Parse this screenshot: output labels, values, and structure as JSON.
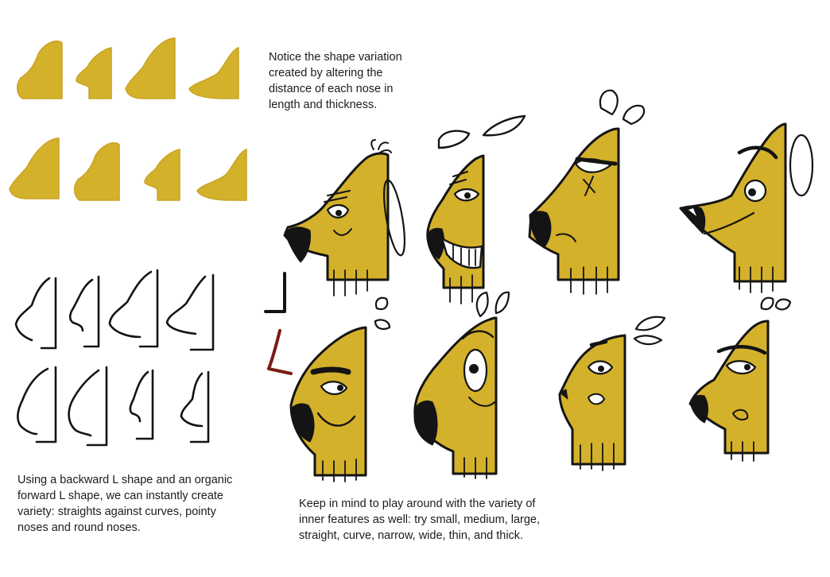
{
  "captions": {
    "top": "Notice the shape variation\ncreated by altering the\ndistance of each nose in\nlength and thickness.",
    "bottom_left": "Using a backward L shape and an organic\nforward L shape, we can instantly create\nvariety: straights against curves, pointy\nnoses and round noses.",
    "bottom_right": "Keep in mind to play around with the variety of\ninner features as well: try small, medium, large,\nstraight, curve, narrow, wide, thin, and thick."
  },
  "colors": {
    "mustard": "#D4B12A",
    "mustard_dark": "#C9A323",
    "ink": "#141414",
    "accent_red": "#7A1C14"
  },
  "icons": {
    "silhouettes": "yellow-nose-silhouette-icon",
    "line_sketches": "backward-l-sketch-icon",
    "dogs": "cartoon-dog-head-icon"
  }
}
